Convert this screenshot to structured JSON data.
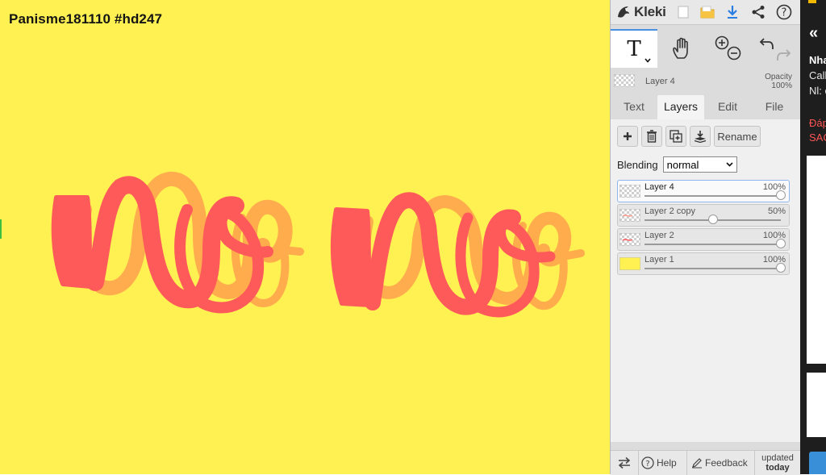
{
  "canvas": {
    "title": "Panisme181110 #hd247",
    "background": "#fff152"
  },
  "topbar": {
    "logo_text": "Kleki",
    "buttons": [
      "new-icon",
      "open-icon",
      "download-icon",
      "share-icon",
      "help-icon"
    ]
  },
  "tools": {
    "text_glyph": "T",
    "items": [
      "text-tool",
      "hand-tool",
      "zoom-in",
      "zoom-out",
      "undo",
      "redo"
    ]
  },
  "current_layer": {
    "name": "Layer 4",
    "opacity_label": "Opacity",
    "opacity_value": "100%"
  },
  "tabs": [
    {
      "label": "Text"
    },
    {
      "label": "Layers"
    },
    {
      "label": "Edit"
    },
    {
      "label": "File"
    }
  ],
  "layers_panel": {
    "rename_label": "Rename",
    "blending_label": "Blending",
    "blending_value": "normal",
    "layers": [
      {
        "name": "Layer 4",
        "opacity": "100%",
        "opacity_fraction": 1.0
      },
      {
        "name": "Layer 2 copy",
        "opacity": "50%",
        "opacity_fraction": 0.5
      },
      {
        "name": "Layer 2",
        "opacity": "100%",
        "opacity_fraction": 1.0
      },
      {
        "name": "Layer 1",
        "opacity": "100%",
        "opacity_fraction": 1.0
      }
    ]
  },
  "bottom": {
    "help": "Help",
    "feedback": "Feedback",
    "updated_line1": "updated",
    "updated_line2": "today"
  },
  "colors": {
    "accent": "#4a90e2",
    "stroke_red": "#ff5a5a",
    "stroke_orange": "#ffa04d",
    "canvas_yellow": "#fff152"
  },
  "right_strip": {
    "lines": [
      "Nha",
      "Call",
      "Nl: c",
      "Đáp",
      "SAC"
    ]
  }
}
